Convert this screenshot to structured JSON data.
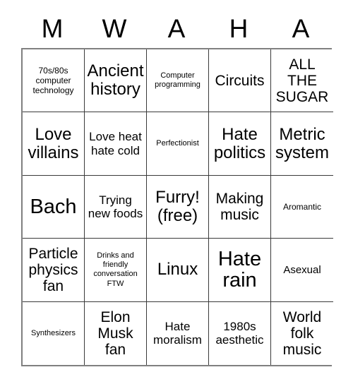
{
  "card": {
    "header_letters": [
      "M",
      "W",
      "A",
      "H",
      "A"
    ],
    "columns": 5,
    "rows": 5,
    "colors": {
      "background": "#ffffff",
      "text": "#000000",
      "outer_border": "#808080",
      "grid_line": "#3a3a3a"
    },
    "cells": [
      {
        "text": "70s/80s computer technology",
        "size": "xs"
      },
      {
        "text": "Ancient history",
        "size": "xl"
      },
      {
        "text": "Computer programming",
        "size": "xxs"
      },
      {
        "text": "Circuits",
        "size": "l"
      },
      {
        "text": "ALL THE SUGAR",
        "size": "l"
      },
      {
        "text": "Love villains",
        "size": "xl"
      },
      {
        "text": "Love heat hate cold",
        "size": "m"
      },
      {
        "text": "Perfectionist",
        "size": "xxs"
      },
      {
        "text": "Hate politics",
        "size": "xl"
      },
      {
        "text": "Metric system",
        "size": "xl"
      },
      {
        "text": "Bach",
        "size": "xxl"
      },
      {
        "text": "Trying new foods",
        "size": "m"
      },
      {
        "text": "Furry! (free)",
        "size": "xl"
      },
      {
        "text": "Making music",
        "size": "l"
      },
      {
        "text": "Aromantic",
        "size": "xs"
      },
      {
        "text": "Particle physics fan",
        "size": "l"
      },
      {
        "text": "Drinks and friendly conversation FTW",
        "size": "xxs"
      },
      {
        "text": "Linux",
        "size": "xl"
      },
      {
        "text": "Hate rain",
        "size": "xxl"
      },
      {
        "text": "Asexual",
        "size": "s"
      },
      {
        "text": "Synthesizers",
        "size": "xxs"
      },
      {
        "text": "Elon Musk fan",
        "size": "l"
      },
      {
        "text": "Hate moralism",
        "size": "m"
      },
      {
        "text": "1980s aesthetic",
        "size": "m"
      },
      {
        "text": "World folk music",
        "size": "l"
      }
    ]
  }
}
